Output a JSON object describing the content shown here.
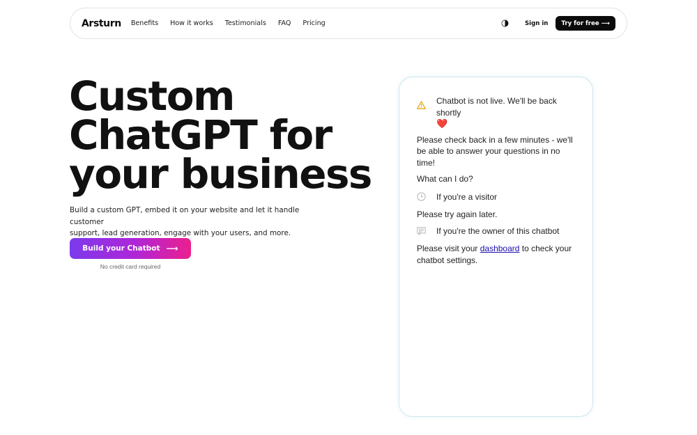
{
  "nav": {
    "logo": "Arsturn",
    "links": [
      "Benefits",
      "How it works",
      "Testimonials",
      "FAQ",
      "Pricing"
    ],
    "theme_toggle_icon": "half-moon-icon",
    "signin": "Sign in",
    "try_btn": "Try for free ⟶"
  },
  "hero": {
    "title_lines": [
      "Custom",
      "ChatGPT for",
      "your business"
    ],
    "description_lines": [
      "Build a custom GPT, embed it on your website and let it handle customer",
      "support, lead generation, engage with your users, and more."
    ],
    "cta_label": "Build your Chatbot",
    "cta_arrow": "⟶",
    "cta_note": "No credit card required"
  },
  "chat": {
    "status_text": "Chatbot is not live. We'll be back shortly",
    "status_heart": "❤️",
    "check_back": "Please check back in a few minutes - we'll be able to answer your questions in no time!",
    "what_can": "What can I do?",
    "visitor_label": "If you're a visitor",
    "visitor_text": "Please try again later.",
    "owner_label": "If you're the owner of this chatbot",
    "owner_text_prefix": "Please visit your",
    "owner_link": "dashboard",
    "owner_text_suffix": "to check your chatbot settings."
  },
  "colors": {
    "cta_start": "#7c3aed",
    "cta_end": "#ec1f8e",
    "warning": "#e6a817",
    "link": "#1a0dab"
  }
}
